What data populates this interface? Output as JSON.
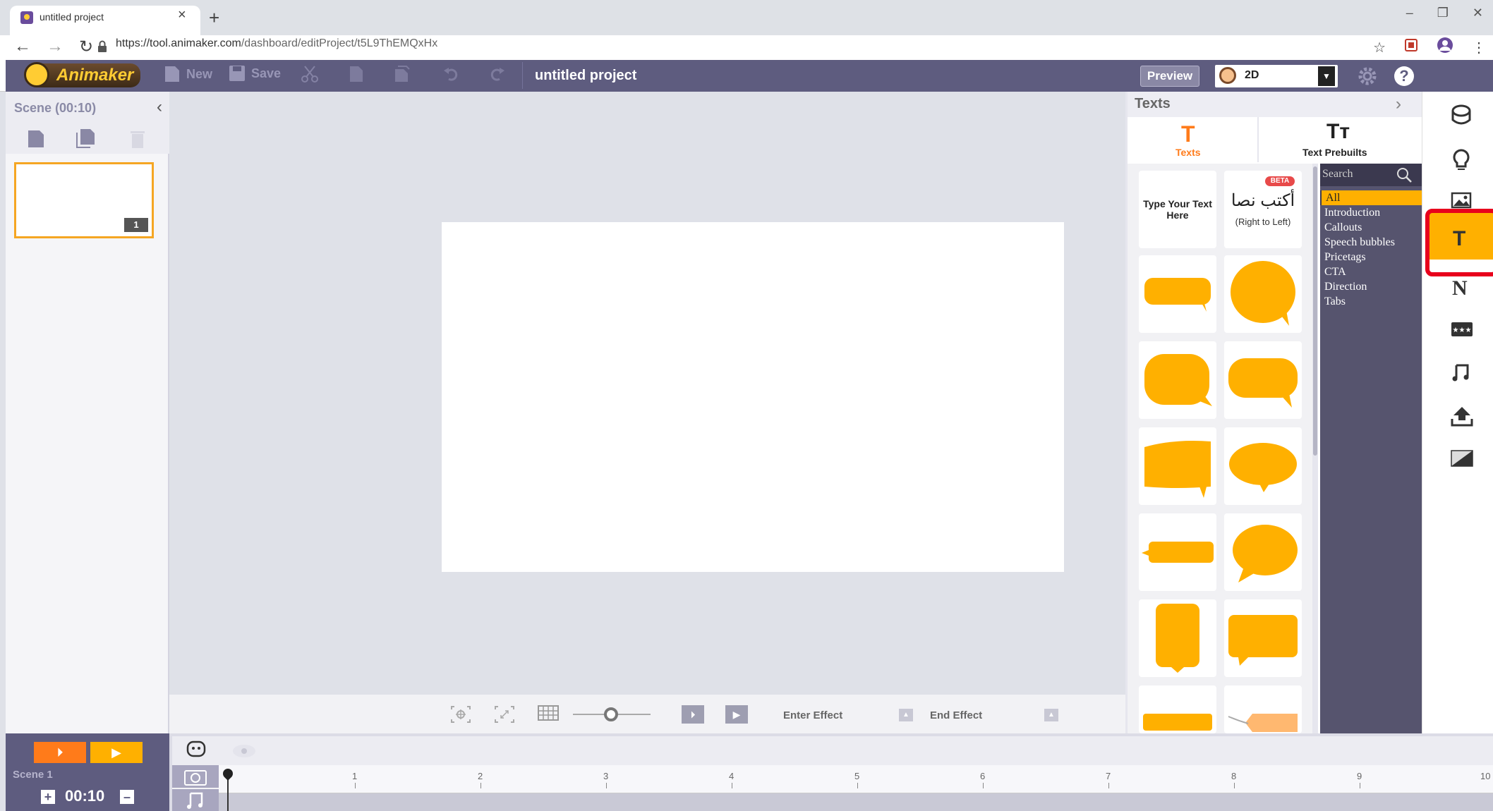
{
  "browser": {
    "tab_title": "untitled project",
    "tab_close": "×",
    "new_tab": "+",
    "url_host": "https://tool.animaker.com",
    "url_path": "/dashboard/editProject/t5L9ThEMQxHx",
    "window_controls": [
      "–",
      "❐",
      "✕"
    ]
  },
  "app": {
    "logo_text": "Animaker",
    "toolbar": {
      "new_label": "New",
      "save_label": "Save"
    },
    "project_title": "untitled project",
    "preview_label": "Preview",
    "mode_value": "2D",
    "help_label": "?"
  },
  "scene_panel": {
    "label": "Scene  (00:10)",
    "collapse_icon": "chevron-left-icon",
    "thumb_badge": "1"
  },
  "stage_bar": {
    "enter_effect_label": "Enter Effect",
    "end_effect_label": "End Effect",
    "zoom_level": 0.4
  },
  "library": {
    "title": "Texts",
    "tabs": [
      {
        "label": "Texts",
        "icon": "T",
        "active": true
      },
      {
        "label": "Text Prebuilts",
        "icon": "Tт",
        "active": false
      }
    ],
    "cards": {
      "type_text": "Type Your Text Here",
      "rtl_badge": "BETA",
      "rtl_arabic": "أكتب نصا",
      "rtl_sub": "(Right to Left)"
    },
    "search_placeholder": "Search",
    "categories": [
      "All",
      "Introduction",
      "Callouts",
      "Speech bubbles",
      "Pricetags",
      "CTA",
      "Direction",
      "Tabs"
    ],
    "accent": "#ffb000"
  },
  "right_bar": {
    "items": [
      "character-icon",
      "bulb-icon",
      "image-icon",
      "text-icon",
      "number-icon",
      "ratings-icon",
      "music-icon",
      "upload-icon",
      "background-icon"
    ],
    "active": "text-icon",
    "text_glyph": "T",
    "number_glyph": "N",
    "highlight_color": "#e8001c"
  },
  "timeline": {
    "scene_label": "Scene 1",
    "duration": "00:10",
    "plus": "+",
    "minus": "–",
    "ticks": [
      "1",
      "2",
      "3",
      "4",
      "5",
      "6",
      "7",
      "8",
      "9",
      "10"
    ]
  }
}
